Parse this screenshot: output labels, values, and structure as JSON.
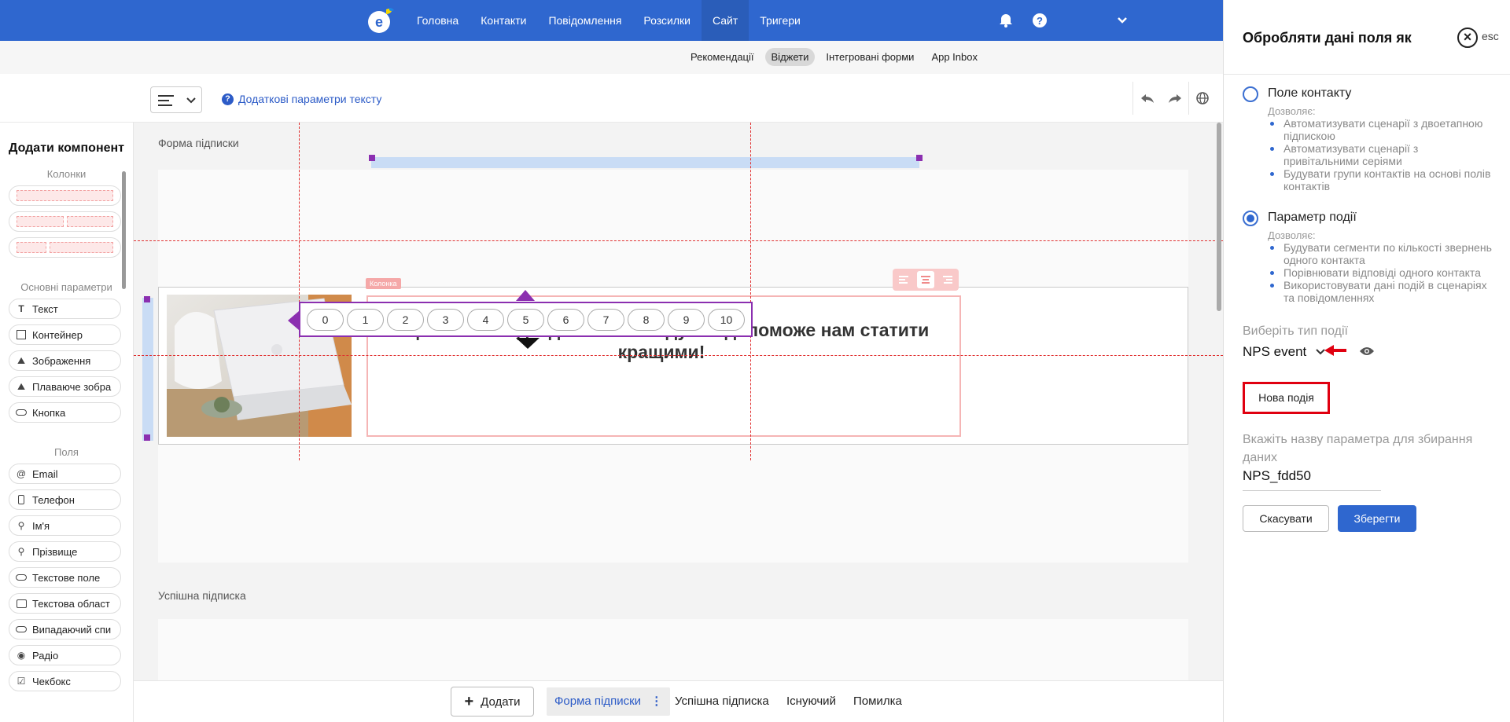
{
  "topnav": {
    "items": [
      "Головна",
      "Контакти",
      "Повідомлення",
      "Розсилки",
      "Сайт",
      "Тригери"
    ],
    "active_index": 4,
    "brand_color": "#2f67cf"
  },
  "subnav": {
    "items": [
      "Рекомендації",
      "Віджети",
      "Інтегровані форми",
      "App Inbox"
    ],
    "active_index": 1
  },
  "toolbar": {
    "add_params_label": "Додаткові параметри тексту"
  },
  "left_panel": {
    "title": "Додати компонент",
    "columns_label": "Колонки",
    "basic_label": "Основні параметри",
    "basic_items": [
      "Текст",
      "Контейнер",
      "Зображення",
      "Плаваюче зобра",
      "Кнопка"
    ],
    "fields_label": "Поля",
    "field_items": [
      "Email",
      "Телефон",
      "Ім'я",
      "Прізвище",
      "Текстове поле",
      "Текстова област",
      "Випадаючий спи",
      "Радіо",
      "Чекбокс"
    ]
  },
  "canvas": {
    "section1_title": "Форма підписки",
    "section2_title": "Успішна підписка",
    "column_tag": "Колонка",
    "question": "Оцініть нас від 1 до 10 - Ваша думка допоможе нам статити кращими!",
    "nps_values": [
      "0",
      "1",
      "2",
      "3",
      "4",
      "5",
      "6",
      "7",
      "8",
      "9",
      "10"
    ]
  },
  "right_panel": {
    "title": "Обробляти дані поля як",
    "esc_label": "esc",
    "option1": {
      "label": "Поле контакту",
      "allows": "Дозволяє:",
      "bullets": [
        "Автоматизувати сценарії з двоетапною підпискою",
        "Автоматизувати сценарії з привітальними серіями",
        "Будувати групи контактів на основі полів контактів"
      ]
    },
    "option2": {
      "label": "Параметр події",
      "allows": "Дозволяє:",
      "bullets": [
        "Будувати сегменти по кількості звернень одного контакта",
        "Порівнювати відповіді одного контакта",
        "Використовувати дані подій в сценаріях та повідомленнях"
      ]
    },
    "selected_option": 2,
    "event_type_label": "Виберіть тип події",
    "event_type_value": "NPS event",
    "new_event_label": "Нова подія",
    "param_name_label": "Вкажіть назву параметра для збирання даних",
    "param_name_value": "NPS_fdd50",
    "cancel_label": "Скасувати",
    "save_label": "Зберегти"
  },
  "bottom_bar": {
    "add_label": "Додати",
    "tabs": [
      "Форма підписки",
      "Успішна підписка",
      "Існуючий",
      "Помилка"
    ],
    "active_index": 0
  }
}
